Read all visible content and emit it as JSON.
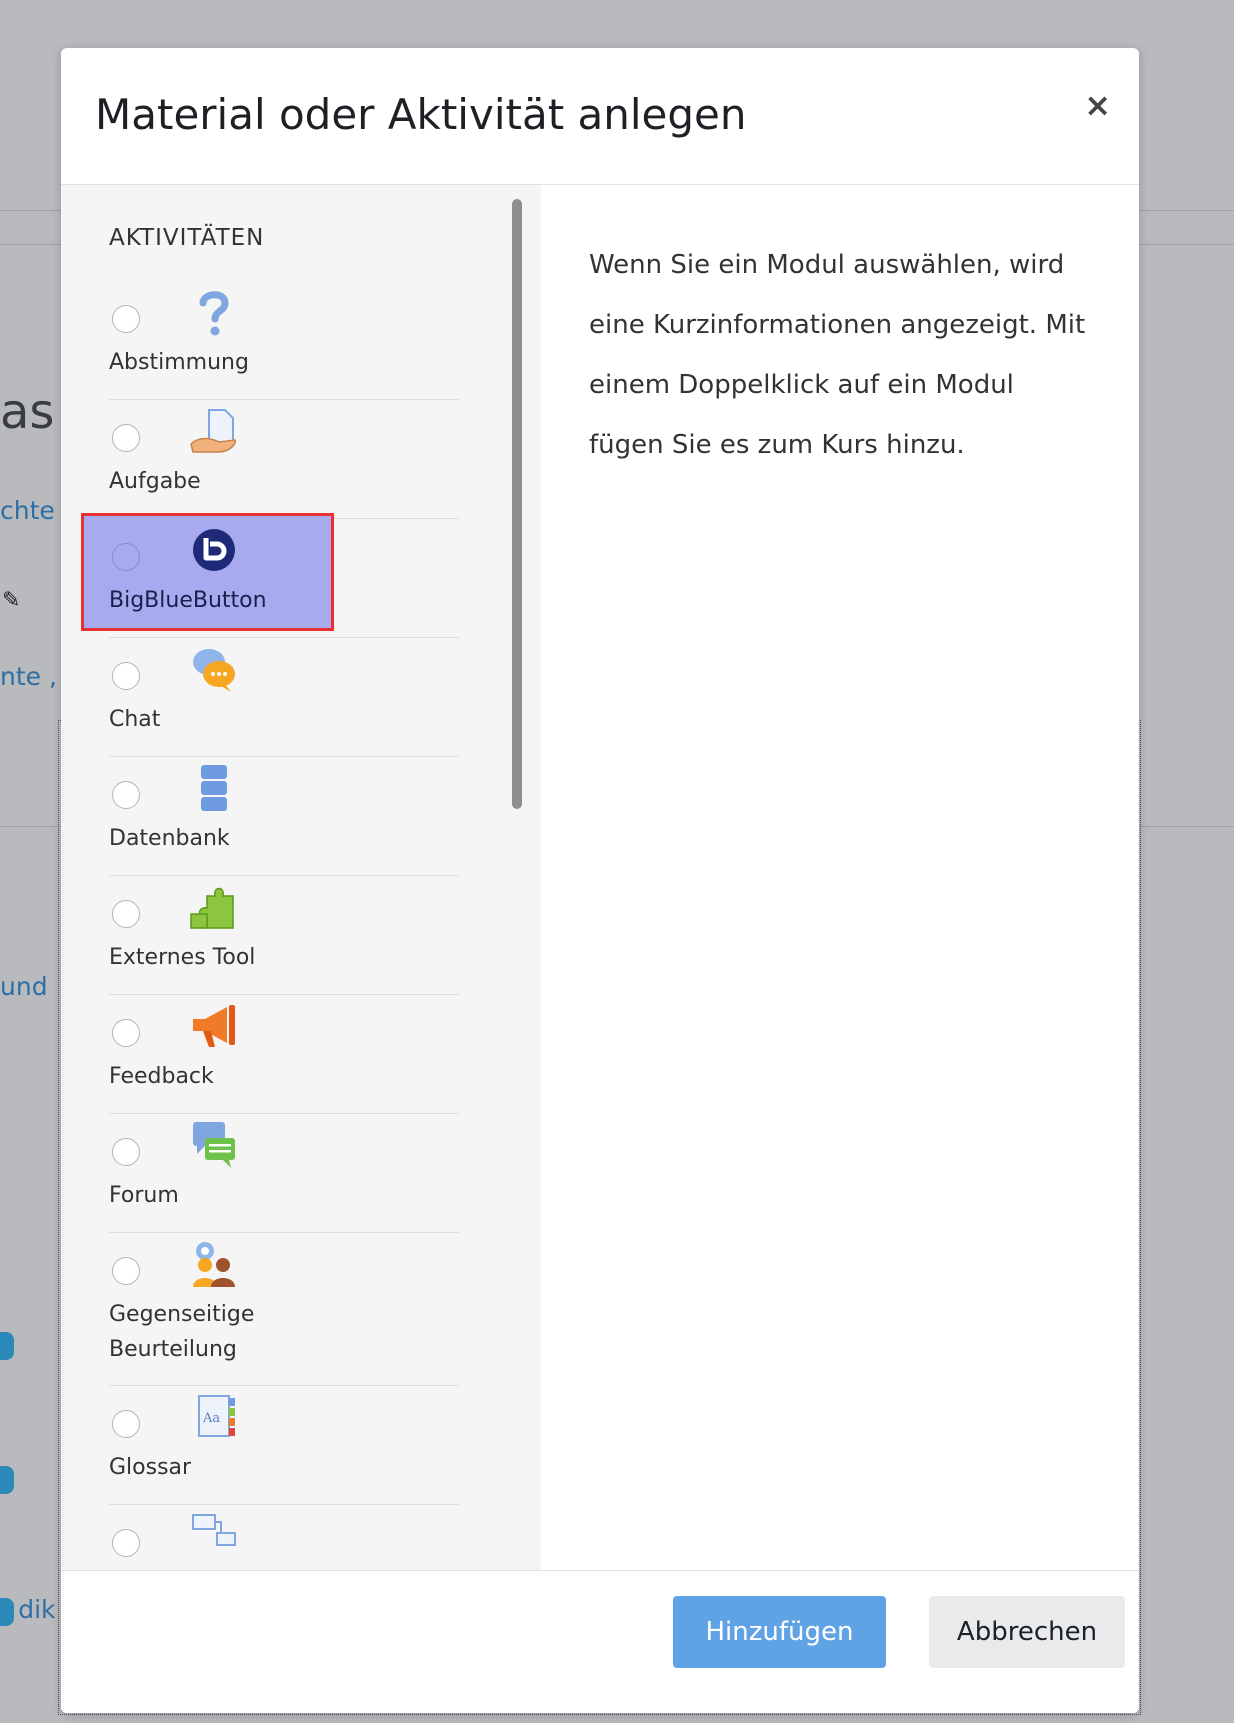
{
  "background": {
    "heading_fragment": "as",
    "link_fragments": [
      "chte",
      "nte ,",
      "und",
      "r dik"
    ]
  },
  "modal": {
    "title": "Material oder Aktivität anlegen",
    "close_symbol": "×",
    "section_label": "AKTIVITÄTEN",
    "modules": [
      {
        "label": "Abstimmung",
        "icon": "question-icon"
      },
      {
        "label": "Aufgabe",
        "icon": "assignment-icon"
      },
      {
        "label": "BigBlueButton",
        "icon": "bigbluebutton-icon",
        "selected": true
      },
      {
        "label": "Chat",
        "icon": "chat-icon"
      },
      {
        "label": "Datenbank",
        "icon": "database-icon"
      },
      {
        "label": "Externes Tool",
        "icon": "puzzle-icon"
      },
      {
        "label": "Feedback",
        "icon": "megaphone-icon"
      },
      {
        "label": "Forum",
        "icon": "forum-icon"
      },
      {
        "label": "Gegenseitige Beurteilung",
        "icon": "workshop-icon"
      },
      {
        "label": "Glossar",
        "icon": "glossary-icon"
      },
      {
        "label": "",
        "icon": "lesson-icon"
      }
    ],
    "help_text": "Wenn Sie ein Modul auswählen, wird eine Kurzinformationen angezeigt. Mit einem Doppelklick auf ein Modul fügen Sie es zum Kurs hinzu.",
    "buttons": {
      "add": "Hinzufügen",
      "cancel": "Abbrechen"
    },
    "colors": {
      "selection_fill": "#a8aaf0",
      "selection_border": "#e8312f",
      "primary_button": "#5fa3e4"
    }
  }
}
